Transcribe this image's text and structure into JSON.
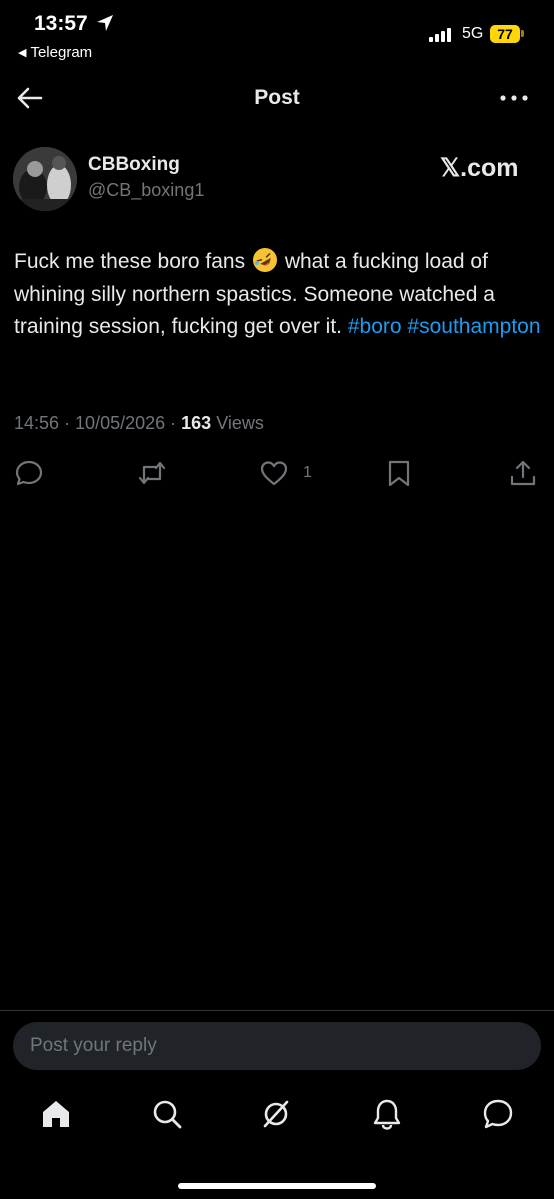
{
  "status_bar": {
    "time": "13:57",
    "back_app": "Telegram",
    "network": "5G",
    "battery": "77"
  },
  "header": {
    "title": "Post"
  },
  "post": {
    "author_name": "CBBoxing",
    "author_handle": "@CB_boxing1",
    "source_badge": "𝕏.com",
    "text_part1": "Fuck me these boro fans",
    "emoji_name": "rolling-on-floor-laughing-emoji",
    "text_part2": "what a fucking load of whining silly northern spastics. Someone watched a training session, fucking get over it.",
    "hashtags": [
      "#boro",
      "#southampton"
    ],
    "time": "14:56",
    "date": "10/05/2026",
    "views_count": "163",
    "views_label": "Views",
    "like_count": "1"
  },
  "reply": {
    "placeholder": "Post your reply"
  },
  "icons": {
    "reply": "reply-icon",
    "repost": "repost-icon",
    "like": "heart-icon",
    "bookmark": "bookmark-icon",
    "share": "share-icon",
    "nav": [
      "home-icon",
      "search-icon",
      "grok-icon",
      "bell-icon",
      "messages-icon"
    ]
  },
  "colors": {
    "background": "#000000",
    "text": "#e7e9ea",
    "secondary": "#71767b",
    "link": "#1d9bf0",
    "battery": "#ffd60a"
  }
}
